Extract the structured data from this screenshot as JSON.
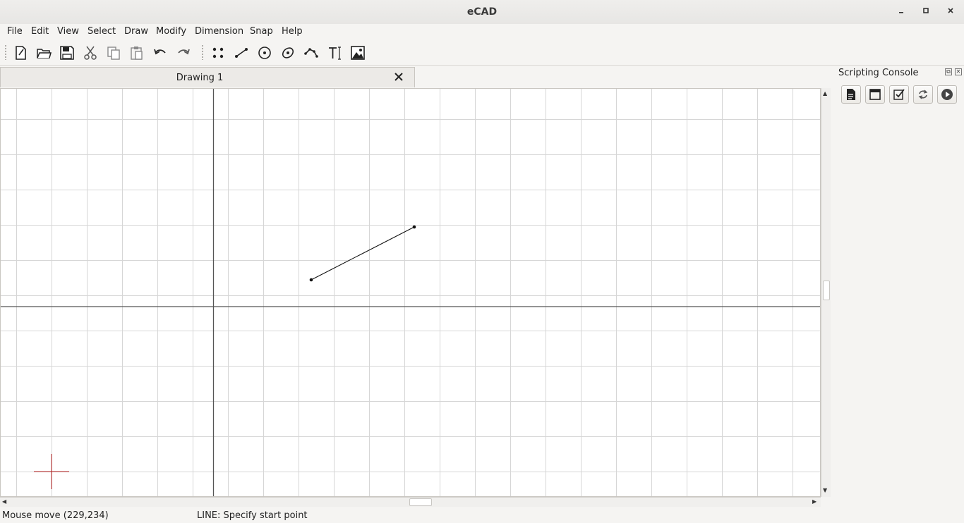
{
  "window": {
    "title": "eCAD"
  },
  "menu": [
    "File",
    "Edit",
    "View",
    "Select",
    "Draw",
    "Modify",
    "Dimension",
    "Snap",
    "Help"
  ],
  "toolbar": {
    "icons": [
      "new-file-icon",
      "open-folder-icon",
      "save-icon",
      "cut-icon",
      "copy-icon",
      "paste-icon",
      "undo-icon",
      "redo-icon",
      "points-icon",
      "line-icon",
      "circle-icon",
      "ellipse-icon",
      "polyline-icon",
      "text-icon",
      "image-icon"
    ]
  },
  "tab": {
    "label": "Drawing 1"
  },
  "dock": {
    "title": "Scripting Console",
    "icons": [
      "script-file-icon",
      "window-icon",
      "checklist-icon",
      "refresh-icon",
      "run-icon"
    ]
  },
  "status": {
    "mouse": "Mouse move (229,234)",
    "command": "LINE: Specify start point"
  },
  "colors": {
    "grid": "#d6d6d6",
    "axis": "#555555",
    "cursor": "#b42020"
  }
}
